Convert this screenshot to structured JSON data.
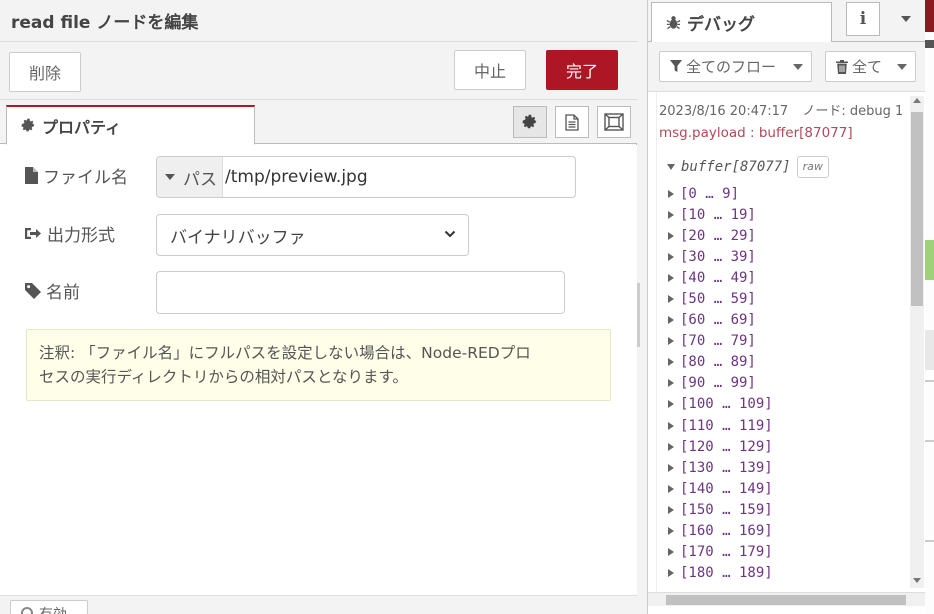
{
  "tray": {
    "title": "read file ノードを編集",
    "buttons": {
      "delete": "削除",
      "cancel": "中止",
      "done": "完了"
    },
    "tab_properties": "プロパティ",
    "fields": {
      "filename_label": "ファイル名",
      "filename_type": "パス",
      "filename_value": "/tmp/preview.jpg",
      "format_label": "出力形式",
      "format_value": "バイナリバッファ",
      "name_label": "名前",
      "name_value": ""
    },
    "tip_line1": "注釈: 「ファイル名」にフルパスを設定しない場合は、Node-REDプロ",
    "tip_line2": "セスの実行ディレクトリからの相対パスとなります。",
    "footer_button": "有効"
  },
  "sidebar": {
    "tab_debug": "デバッグ",
    "info_button": "i",
    "filter_label": "全てのフロー",
    "clear_label": "全て",
    "message": {
      "timestamp": "2023/8/16 20:47:17",
      "node": "ノード: debug 1",
      "topic": "msg.payload : buffer[87077]",
      "root": "buffer[87077]",
      "raw": "raw",
      "items": [
        "[0 … 9]",
        "[10 … 19]",
        "[20 … 29]",
        "[30 … 39]",
        "[40 … 49]",
        "[50 … 59]",
        "[60 … 69]",
        "[70 … 79]",
        "[80 … 89]",
        "[90 … 99]",
        "[100 … 109]",
        "[110 … 119]",
        "[120 … 129]",
        "[130 … 139]",
        "[140 … 149]",
        "[150 … 159]",
        "[160 … 169]",
        "[170 … 179]",
        "[180 … 189]"
      ]
    }
  },
  "colors": {
    "accent": "#ad1625",
    "tip_background": "#fefee9",
    "topic_text": "#b2495a",
    "tree_text": "#6c3483"
  }
}
